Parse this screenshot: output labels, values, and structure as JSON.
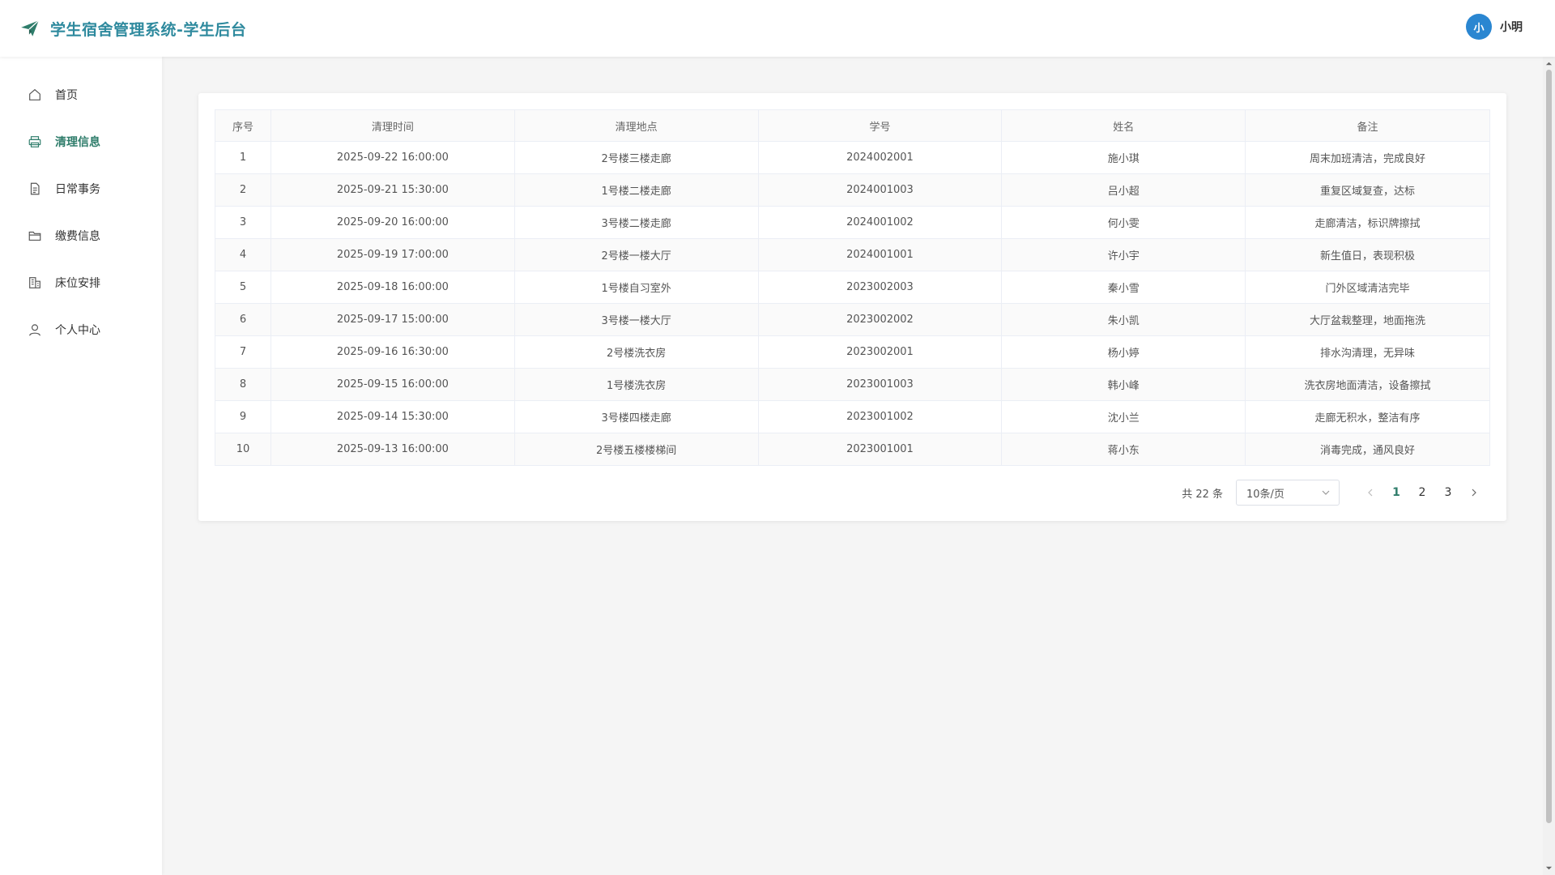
{
  "header": {
    "title": "学生宿舍管理系统-学生后台",
    "brand_color": "#2f8a9e"
  },
  "user": {
    "avatar_text": "小",
    "name": "小明"
  },
  "sidebar": {
    "items": [
      {
        "label": "首页",
        "icon": "home-icon",
        "active": false
      },
      {
        "label": "清理信息",
        "icon": "printer-icon",
        "active": true
      },
      {
        "label": "日常事务",
        "icon": "document-icon",
        "active": false
      },
      {
        "label": "缴费信息",
        "icon": "folder-icon",
        "active": false
      },
      {
        "label": "床位安排",
        "icon": "building-icon",
        "active": false
      },
      {
        "label": "个人中心",
        "icon": "user-icon",
        "active": false
      }
    ],
    "active_color": "#2f7d6b"
  },
  "table": {
    "columns": [
      "序号",
      "清理时间",
      "清理地点",
      "学号",
      "姓名",
      "备注"
    ],
    "rows": [
      [
        "1",
        "2025-09-22 16:00:00",
        "2号楼三楼走廊",
        "2024002001",
        "施小琪",
        "周末加班清洁，完成良好"
      ],
      [
        "2",
        "2025-09-21 15:30:00",
        "1号楼二楼走廊",
        "2024001003",
        "吕小超",
        "重复区域复查，达标"
      ],
      [
        "3",
        "2025-09-20 16:00:00",
        "3号楼二楼走廊",
        "2024001002",
        "何小雯",
        "走廊清洁，标识牌擦拭"
      ],
      [
        "4",
        "2025-09-19 17:00:00",
        "2号楼一楼大厅",
        "2024001001",
        "许小宇",
        "新生值日，表现积极"
      ],
      [
        "5",
        "2025-09-18 16:00:00",
        "1号楼自习室外",
        "2023002003",
        "秦小雪",
        "门外区域清洁完毕"
      ],
      [
        "6",
        "2025-09-17 15:00:00",
        "3号楼一楼大厅",
        "2023002002",
        "朱小凯",
        "大厅盆栽整理，地面拖洗"
      ],
      [
        "7",
        "2025-09-16 16:30:00",
        "2号楼洗衣房",
        "2023002001",
        "杨小婷",
        "排水沟清理，无异味"
      ],
      [
        "8",
        "2025-09-15 16:00:00",
        "1号楼洗衣房",
        "2023001003",
        "韩小峰",
        "洗衣房地面清洁，设备擦拭"
      ],
      [
        "9",
        "2025-09-14 15:30:00",
        "3号楼四楼走廊",
        "2023001002",
        "沈小兰",
        "走廊无积水，整洁有序"
      ],
      [
        "10",
        "2025-09-13 16:00:00",
        "2号楼五楼楼梯间",
        "2023001001",
        "蒋小东",
        "消毒完成，通风良好"
      ]
    ]
  },
  "pagination": {
    "total_text": "共 22 条",
    "page_size": "10条/页",
    "pages": [
      "1",
      "2",
      "3"
    ],
    "current_page": "1"
  }
}
